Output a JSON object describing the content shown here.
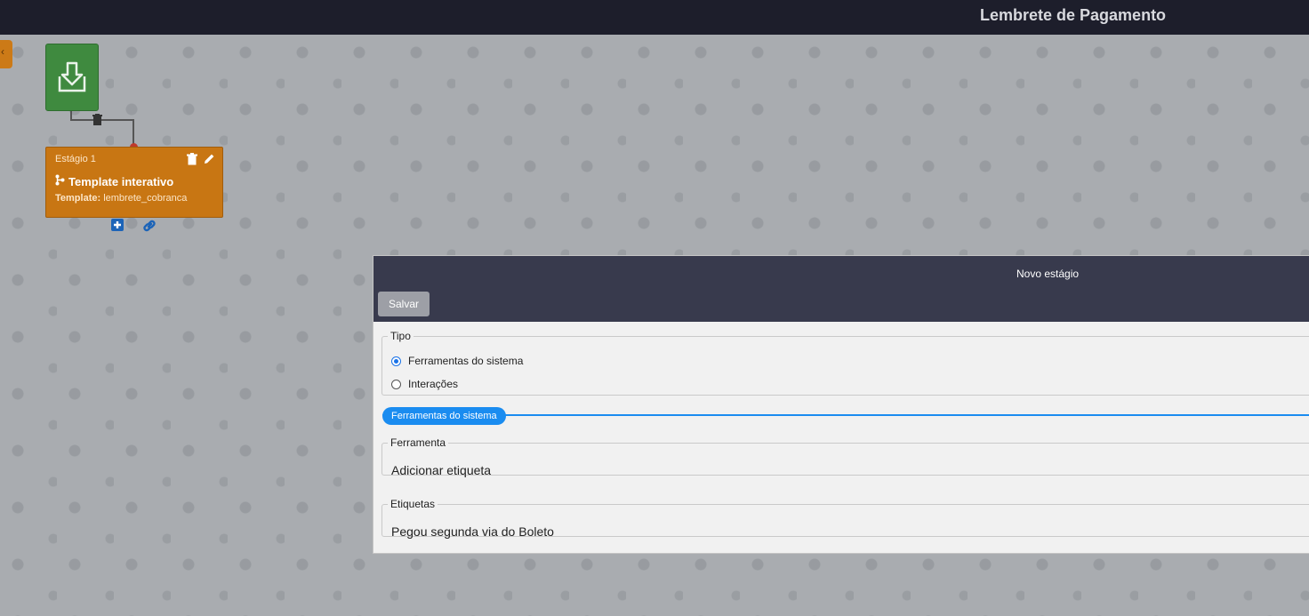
{
  "header": {
    "title": "Lembrete de Pagamento"
  },
  "flow": {
    "stage": {
      "label": "Estágio 1",
      "title": "Template interativo",
      "template_key": "Template:",
      "template_value": "lembrete_cobranca"
    }
  },
  "dialog": {
    "title": "Novo estágio",
    "save_label": "Salvar",
    "tipo": {
      "legend": "Tipo",
      "options": [
        "Ferramentas do sistema",
        "Interações"
      ],
      "selected": "Ferramentas do sistema"
    },
    "section_label": "Ferramentas do sistema",
    "ferramenta": {
      "legend": "Ferramenta",
      "value": "Adicionar etiqueta"
    },
    "etiquetas": {
      "legend": "Etiquetas",
      "value": "Pegou segunda via do Boleto"
    }
  },
  "colors": {
    "header_bg": "#1d1e2b",
    "start_node": "#3f8a3f",
    "stage_node": "#c87613",
    "accent_blue": "#1a8cf0",
    "accent_orange": "#e08a1e"
  }
}
